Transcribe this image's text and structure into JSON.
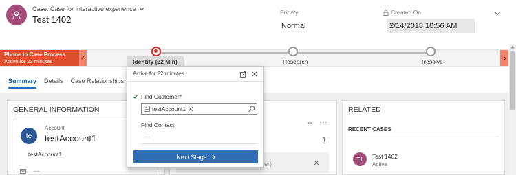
{
  "header": {
    "case_type": "Case: Case for Interactive experience",
    "title": "Test 1402",
    "priority_label": "Priority",
    "priority_value": "Normal",
    "created_label": "Created On",
    "created_value": "2/14/2018 10:56 AM"
  },
  "process": {
    "name": "Phone to Case Process",
    "active_for": "Active for 22 minutes",
    "stages": [
      {
        "label": "Identify  (22 Min)",
        "state": "active"
      },
      {
        "label": "Research",
        "state": "inactive"
      },
      {
        "label": "Resolve",
        "state": "inactive"
      }
    ]
  },
  "tabs": [
    "Summary",
    "Details",
    "Case Relationships"
  ],
  "active_tab": "Summary",
  "flyout": {
    "header": "Active for 22 minutes",
    "find_customer_label": "Find Customer",
    "required_mark": "*",
    "customer_value": "testAccount1",
    "find_contact_label": "Find Contact",
    "contact_value": "---",
    "next_stage_label": "Next Stage"
  },
  "general": {
    "title": "GENERAL INFORMATION",
    "account_label": "Account",
    "account_name": "testAccount1",
    "account_initials": "te",
    "account_sub": "testAccount1",
    "email_value": "---"
  },
  "middle": {
    "partial_text": "er)"
  },
  "related": {
    "title": "RELATED",
    "recent_cases_label": "RECENT CASES",
    "case_initials": "T1",
    "case_title": "Test 1402",
    "case_status": "Active"
  },
  "colors": {
    "process_accent": "#e04f2d",
    "active_stage": "#d92b2b",
    "primary_button": "#2f6eb5",
    "avatar_case": "#a44b7b",
    "avatar_account": "#2b5797"
  }
}
